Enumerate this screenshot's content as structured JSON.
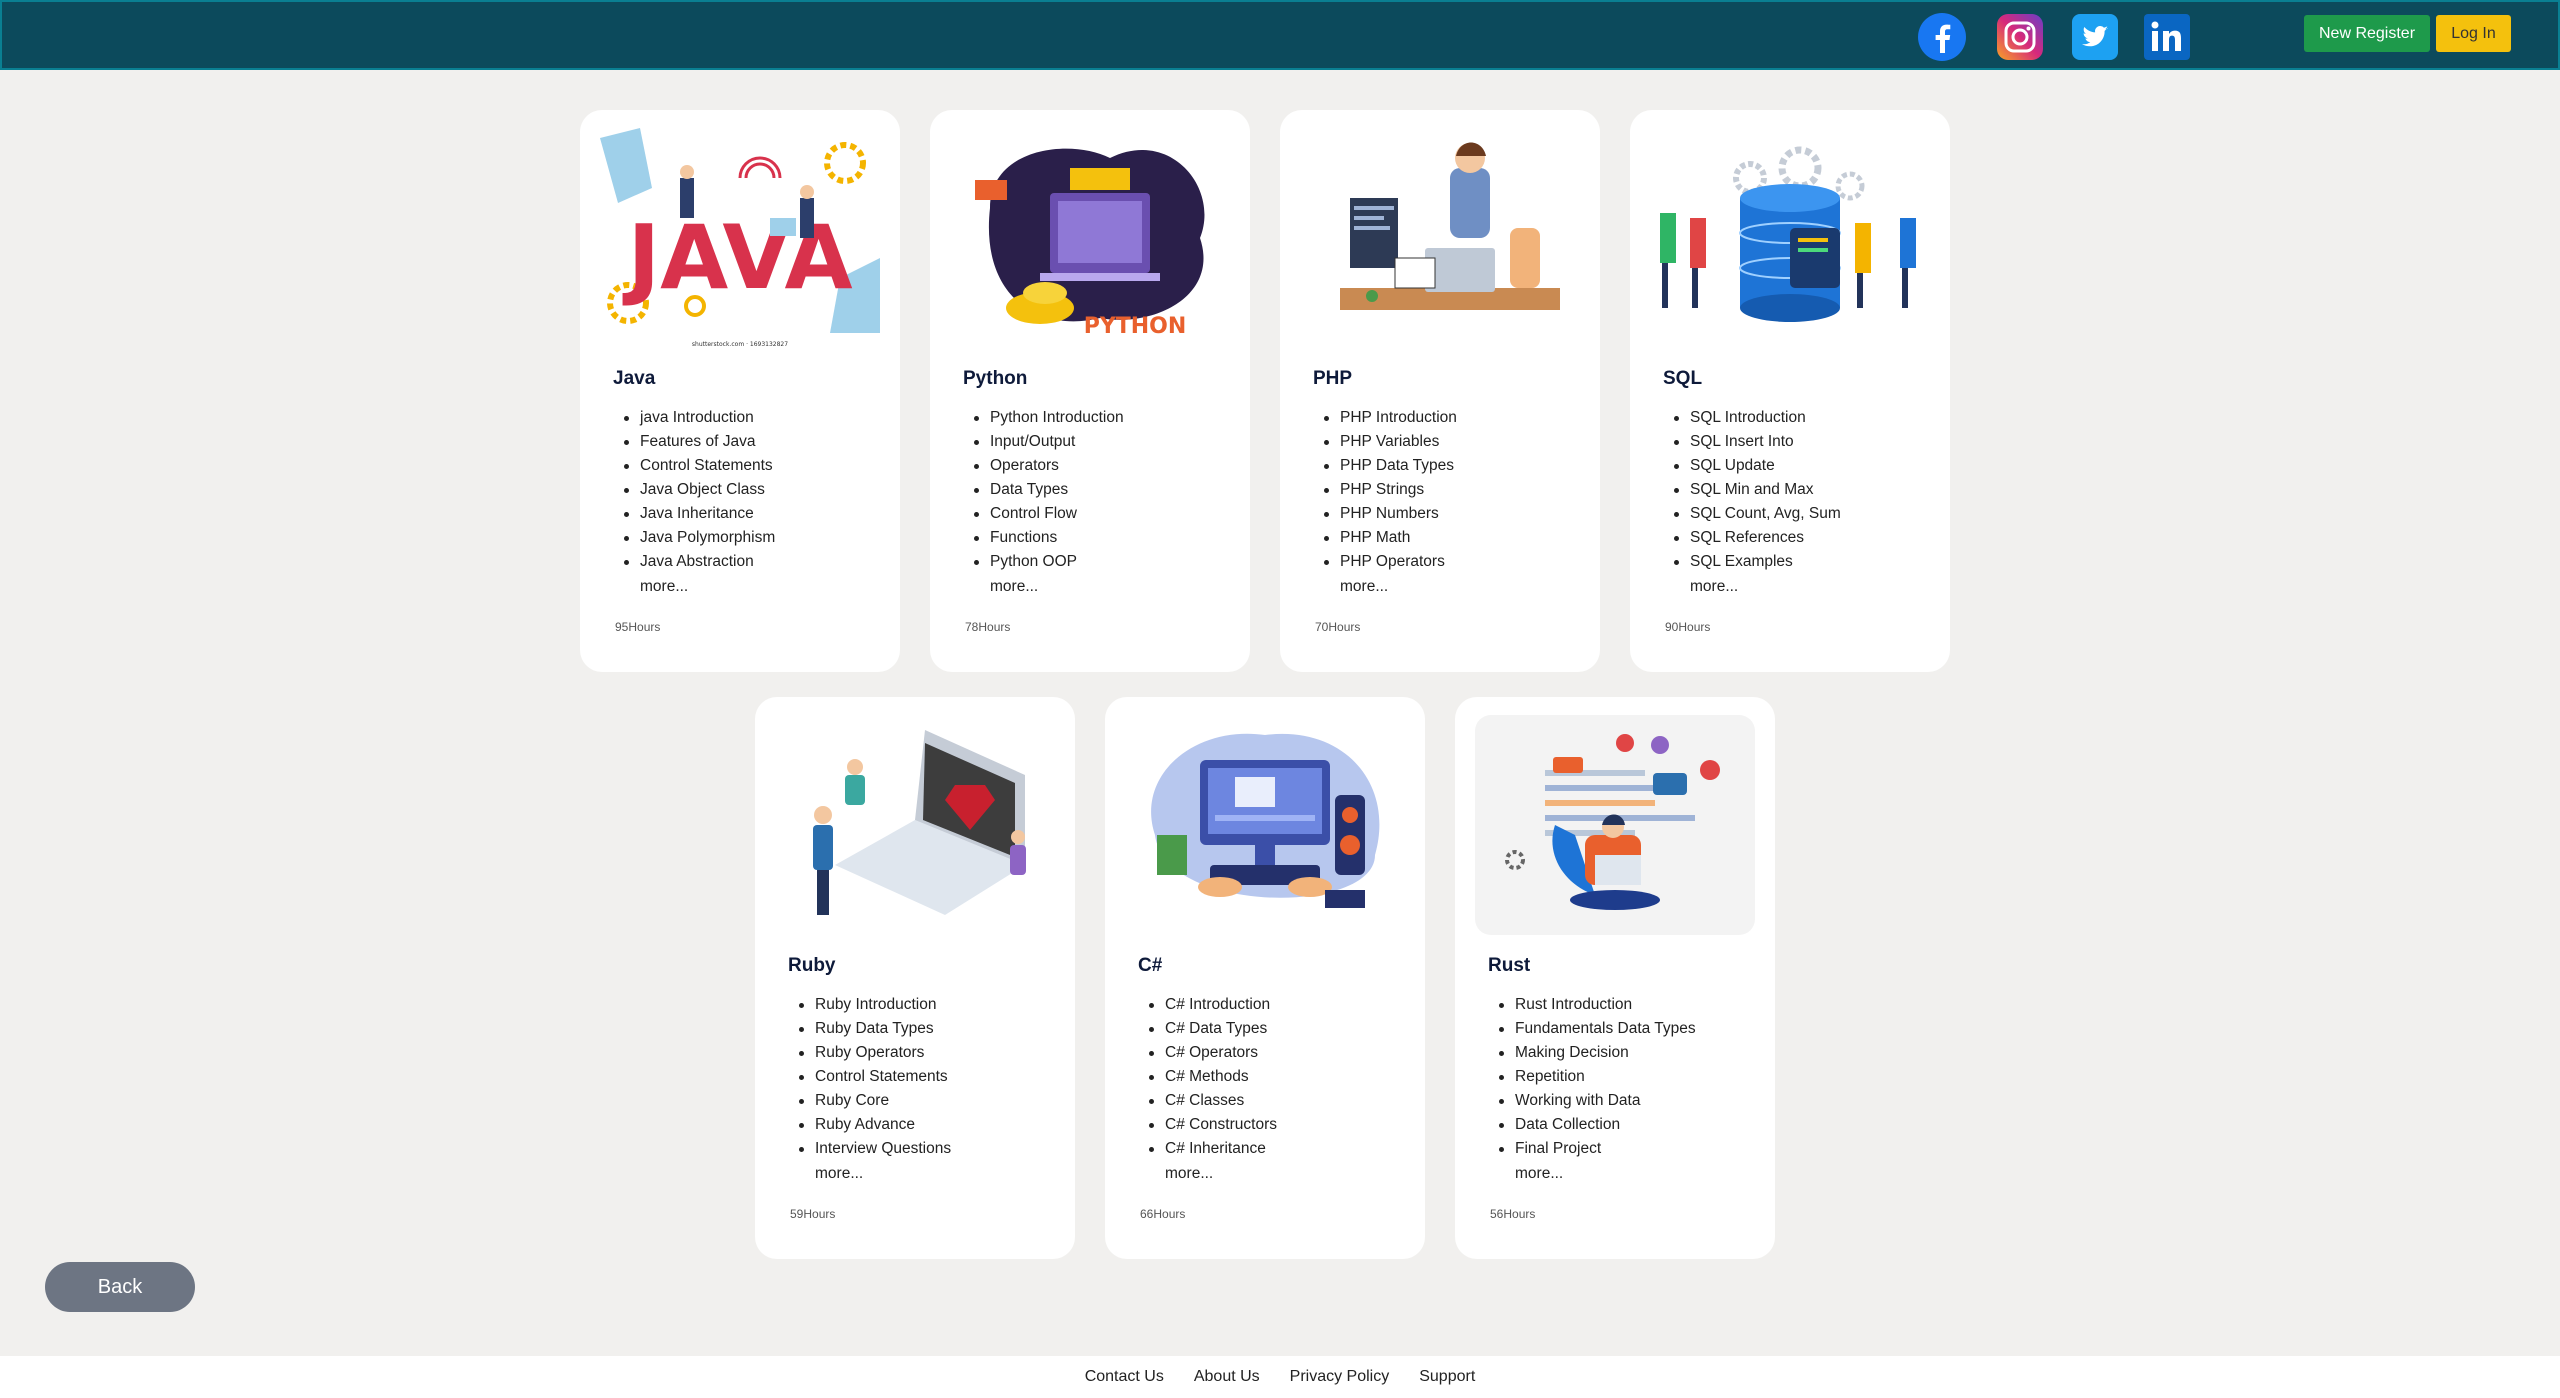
{
  "header": {
    "social": [
      {
        "name": "facebook-icon",
        "color": "#1877f2"
      },
      {
        "name": "instagram-icon",
        "color": "#c13584"
      },
      {
        "name": "twitter-icon",
        "color": "#1da1f2"
      },
      {
        "name": "linkedin-icon",
        "color": "#0a66c2"
      }
    ],
    "register_label": "New Register",
    "login_label": "Log In"
  },
  "courses": [
    {
      "title": "Java",
      "items": [
        "java Introduction",
        "Features of Java",
        "Control Statements",
        "Java Object Class",
        "Java Inheritance",
        "Java Polymorphism",
        "Java Abstraction"
      ],
      "more": "more...",
      "hours": "95Hours",
      "illustration": "java-illustration",
      "watermark": "shutterstock.com · 1693132827"
    },
    {
      "title": "Python",
      "items": [
        "Python Introduction",
        "Input/Output",
        "Operators",
        "Data Types",
        "Control Flow",
        "Functions",
        "Python OOP"
      ],
      "more": "more...",
      "hours": "78Hours",
      "illustration": "python-illustration",
      "logo_text": "PYTHON"
    },
    {
      "title": "PHP",
      "items": [
        "PHP Introduction",
        "PHP Variables",
        "PHP Data Types",
        "PHP Strings",
        "PHP Numbers",
        "PHP Math",
        "PHP Operators"
      ],
      "more": "more...",
      "hours": "70Hours",
      "illustration": "php-illustration"
    },
    {
      "title": "SQL",
      "items": [
        "SQL Introduction",
        "SQL Insert Into",
        "SQL Update",
        "SQL Min and Max",
        "SQL Count, Avg, Sum",
        "SQL References",
        "SQL Examples"
      ],
      "more": "more...",
      "hours": "90Hours",
      "illustration": "sql-illustration"
    },
    {
      "title": "Ruby",
      "items": [
        "Ruby Introduction",
        "Ruby Data Types",
        "Ruby Operators",
        "Control Statements",
        "Ruby Core",
        "Ruby Advance",
        "Interview Questions"
      ],
      "more": "more...",
      "hours": "59Hours",
      "illustration": "ruby-illustration"
    },
    {
      "title": "C#",
      "items": [
        "C# Introduction",
        "C# Data Types",
        "C# Operators",
        "C# Methods",
        "C# Classes",
        "C# Constructors",
        "C# Inheritance"
      ],
      "more": "more...",
      "hours": "66Hours",
      "illustration": "csharp-illustration"
    },
    {
      "title": "Rust",
      "items": [
        "Rust Introduction",
        "Fundamentals Data Types",
        "Making Decision",
        "Repetition",
        "Working with Data",
        "Data Collection",
        "Final Project"
      ],
      "more": "more...",
      "hours": "56Hours",
      "illustration": "rust-illustration"
    }
  ],
  "back_label": "Back",
  "footer": {
    "links": [
      "Contact Us",
      "About Us",
      "Privacy Policy",
      "Support"
    ]
  },
  "colors": {
    "header_bg": "#0c4a5c",
    "register_bg": "#1e9a4b",
    "login_bg": "#f4c10d",
    "back_bg": "#6d7583",
    "page_bg": "#f1f0ee"
  }
}
